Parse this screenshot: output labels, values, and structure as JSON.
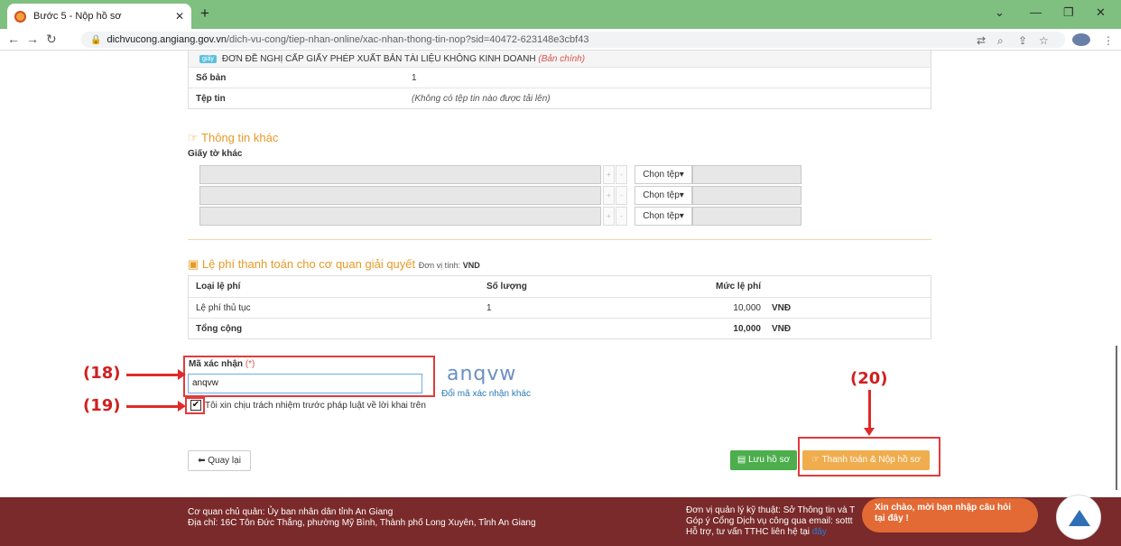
{
  "browser": {
    "tab_title": "Bước 5 - Nộp hồ sơ",
    "url_domain": "dichvucong.angiang.gov.vn",
    "url_path": "/dich-vu-cong/tiep-nhan-online/xac-nhan-thong-tin-nop?sid=40472-623148e3cbf43"
  },
  "document": {
    "badge": "giấy",
    "name": "ĐƠN ĐỀ NGHỊ CẤP GIẤY PHÉP XUẤT BẢN TÀI LIỆU KHÔNG KINH DOANH",
    "note": "(Bản chính)",
    "copies_label": "Số bản",
    "copies_value": "1",
    "file_label": "Tệp tin",
    "file_value": "(Không có tệp tin nào được tải lên)"
  },
  "other_info": {
    "title": "Thông tin khác",
    "sub_label": "Giấy tờ khác",
    "choose_label": "Chọn tệp",
    "plus": "+",
    "minus": "-"
  },
  "fees": {
    "title": "Lệ phí thanh toán cho cơ quan giải quyết",
    "unit_prefix": "Đơn vị tính:",
    "unit": "VND",
    "headers": [
      "Loại lệ phí",
      "Số lượng",
      "Mức lệ phí"
    ],
    "row": {
      "type": "Lệ phí thủ tục",
      "qty": "1",
      "amount": "10,000",
      "currency": "VNĐ"
    },
    "total": {
      "label": "Tổng cộng",
      "amount": "10,000",
      "currency": "VNĐ"
    }
  },
  "captcha": {
    "label": "Mã xác nhận",
    "required": "(*)",
    "input_value": "anqvw",
    "image_text": "anqvw",
    "refresh": "Đổi mã xác nhận khác",
    "checkbox_label": "Tôi xin chịu trách nhiệm trước pháp luật về lời khai trên",
    "checked": true
  },
  "annotations": {
    "a18": "(18)",
    "a19": "(19)",
    "a20": "(20)"
  },
  "buttons": {
    "back": "Quay lại",
    "save": "Lưu hồ sơ",
    "pay": "Thanh toán & Nộp hồ sơ"
  },
  "footer": {
    "owner": "Cơ quan chủ quản: Ủy ban nhân dân tỉnh An Giang",
    "address": "Địa chỉ: 16C Tôn Đức Thắng, phường Mỹ Bình, Thành phố Long Xuyên, Tỉnh An Giang",
    "tech": "Đơn vị quản lý kỹ thuật: Sở Thông tin và T",
    "feedback": "Góp ý Cổng Dịch vụ công qua email: sottt",
    "support": "Hỗ trợ, tư vấn TTHC liên hệ tại",
    "support_link": "đây"
  },
  "chat": {
    "line1": "Xin chào, mời bạn nhập câu hỏi",
    "line2": "tại đây !"
  }
}
